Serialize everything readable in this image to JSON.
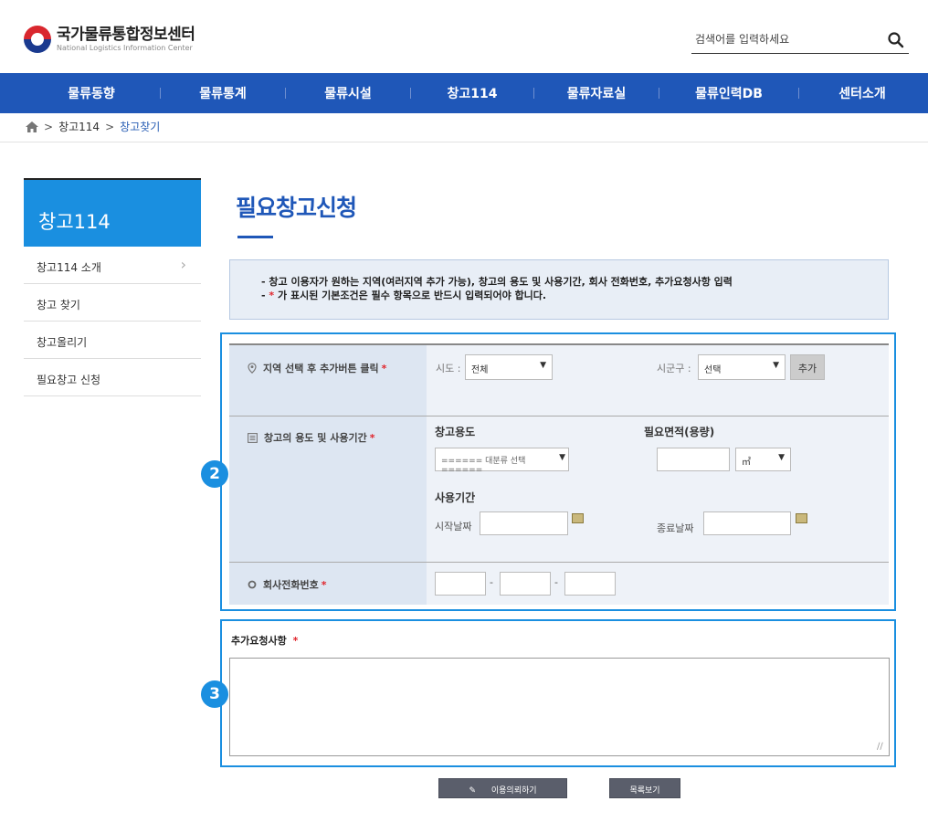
{
  "header": {
    "logo_ko": "국가물류통합정보센터",
    "logo_en": "National Logistics Information Center",
    "search_placeholder": "검색어를 입력하세요"
  },
  "gnb": {
    "items": [
      "물류동향",
      "물류통계",
      "물류시설",
      "창고114",
      "물류자료실",
      "물류인력DB",
      "센터소개"
    ]
  },
  "breadcrumb": {
    "home_icon": "home-icon",
    "items": [
      "창고114",
      "창고찾기"
    ]
  },
  "lnb": {
    "title": "창고114",
    "items": [
      "창고114 소개",
      "창고 찾기",
      "창고올리기",
      "필요창고 신청"
    ]
  },
  "main": {
    "title": "필요창고신청",
    "notice_line1": "- 창고 이용자가 원하는 지역(여러지역 추가 가능), 창고의 용도 및 사용기간, 회사 전화번호, 추가요청사항 입력",
    "notice_line2_prefix": "- ",
    "notice_line2_star": "*",
    "notice_line2_rest": " 가 표시된 기본조건은 필수 항목으로 반드시 입력되어야 합니다.",
    "required_mark": "*",
    "region": {
      "label": "지역 선택 후 추가버튼 클릭",
      "sido_label": "시도 :",
      "sido_value": "전체",
      "sigungu_label": "시군구 :",
      "sigungu_value": "선택",
      "add_button": "추가"
    },
    "usage": {
      "label": "창고의 용도 및 사용기간",
      "usage_title": "창고용도",
      "usage_select": "====== 대분류 선택 ======",
      "area_title": "필요면적(용량)",
      "area_unit": "㎡",
      "period_title": "사용기간",
      "start_label": "시작날짜",
      "end_label": "종료날짜"
    },
    "phone": {
      "label": "회사전화번호",
      "dash": "-"
    },
    "extra": {
      "label": "추가요청사항"
    },
    "badges": [
      "2",
      "3"
    ],
    "buttons": {
      "apply": "이용의뢰하기",
      "list": "목록보기"
    }
  }
}
